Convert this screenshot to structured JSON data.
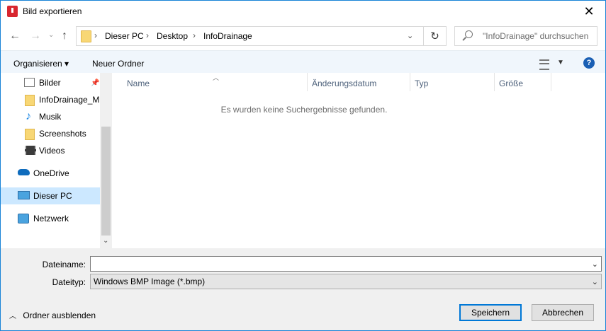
{
  "window": {
    "title": "Bild exportieren"
  },
  "address": {
    "crumbs": [
      "Dieser PC",
      "Desktop",
      "InfoDrainage"
    ],
    "separator": "›"
  },
  "search": {
    "placeholder": "\"InfoDrainage\" durchsuchen"
  },
  "toolbar": {
    "organize": "Organisieren ▾",
    "new_folder": "Neuer Ordner"
  },
  "sidebar": {
    "items": [
      {
        "label": "Bilder",
        "icon": "pictures-icon"
      },
      {
        "label": "InfoDrainage_M",
        "icon": "folder-icon"
      },
      {
        "label": "Musik",
        "icon": "music-icon"
      },
      {
        "label": "Screenshots",
        "icon": "folder-icon"
      },
      {
        "label": "Videos",
        "icon": "videos-icon"
      },
      {
        "label": "OneDrive",
        "icon": "cloud-icon"
      },
      {
        "label": "Dieser PC",
        "icon": "pc-icon"
      },
      {
        "label": "Netzwerk",
        "icon": "network-icon"
      }
    ]
  },
  "columns": [
    "Name",
    "Änderungsdatum",
    "Typ",
    "Größe"
  ],
  "empty_message": "Es wurden keine Suchergebnisse gefunden.",
  "form": {
    "filename_label": "Dateiname:",
    "filename_value": "",
    "filetype_label": "Dateityp:",
    "filetype_value": "Windows BMP Image (*.bmp)"
  },
  "footer": {
    "hide_folders": "Ordner ausblenden",
    "save": "Speichern",
    "cancel": "Abbrechen"
  },
  "colors": {
    "accent": "#0078d7",
    "selected": "#cce8ff",
    "toolbar_bg": "#f0f6fc"
  }
}
